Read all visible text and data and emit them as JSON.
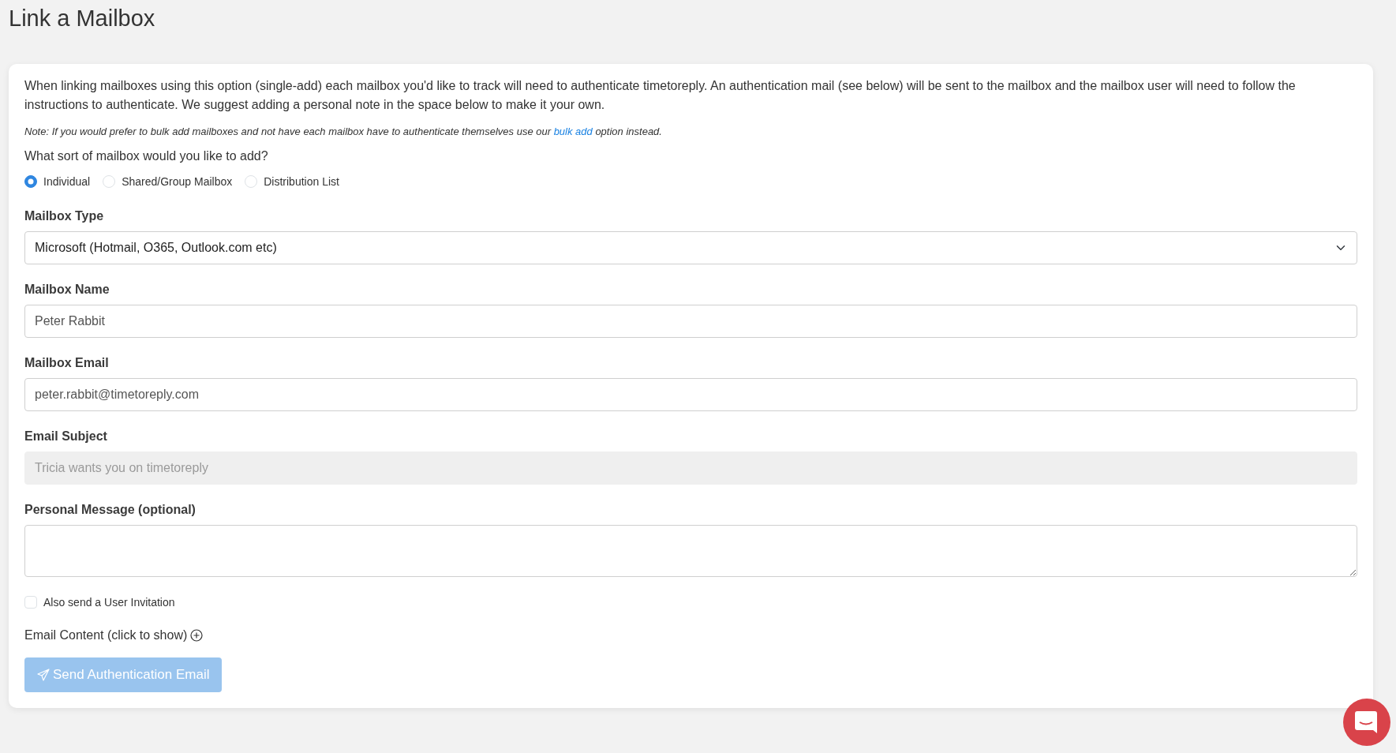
{
  "page": {
    "title": "Link a Mailbox"
  },
  "intro": "When linking mailboxes using this option (single-add) each mailbox you'd like to track will need to authenticate timetoreply. An authentication mail (see below) will be sent to the mailbox and the mailbox user will need to follow the instructions to authenticate. We suggest adding a personal note in the space below to make it your own.",
  "note": {
    "before": "Note: If you would prefer to bulk add mailboxes and not have each mailbox have to authenticate themselves use our ",
    "link": "bulk add",
    "after": " option instead."
  },
  "question": "What sort of mailbox would you like to add?",
  "mailbox_kinds": [
    {
      "label": "Individual",
      "selected": true
    },
    {
      "label": "Shared/Group Mailbox",
      "selected": false
    },
    {
      "label": "Distribution List",
      "selected": false
    }
  ],
  "fields": [
    {
      "kind": "select",
      "label": "Mailbox Type",
      "value": "Microsoft (Hotmail, O365, Outlook.com etc)",
      "disabled": false
    },
    {
      "kind": "text",
      "label": "Mailbox Name",
      "placeholder": "Peter Rabbit",
      "disabled": false
    },
    {
      "kind": "text",
      "label": "Mailbox Email",
      "placeholder": "peter.rabbit@timetoreply.com",
      "disabled": false
    },
    {
      "kind": "text",
      "label": "Email Subject",
      "value": "Tricia wants you on timetoreply",
      "disabled": true
    },
    {
      "kind": "textarea",
      "label": "Personal Message (optional)",
      "disabled": false
    }
  ],
  "user_invitation": {
    "label": "Also send a User Invitation",
    "checked": false
  },
  "email_content": {
    "label": "Email Content (click to show)",
    "expanded": false
  },
  "send_button": {
    "label": "Send Authentication Email",
    "disabled": true
  }
}
